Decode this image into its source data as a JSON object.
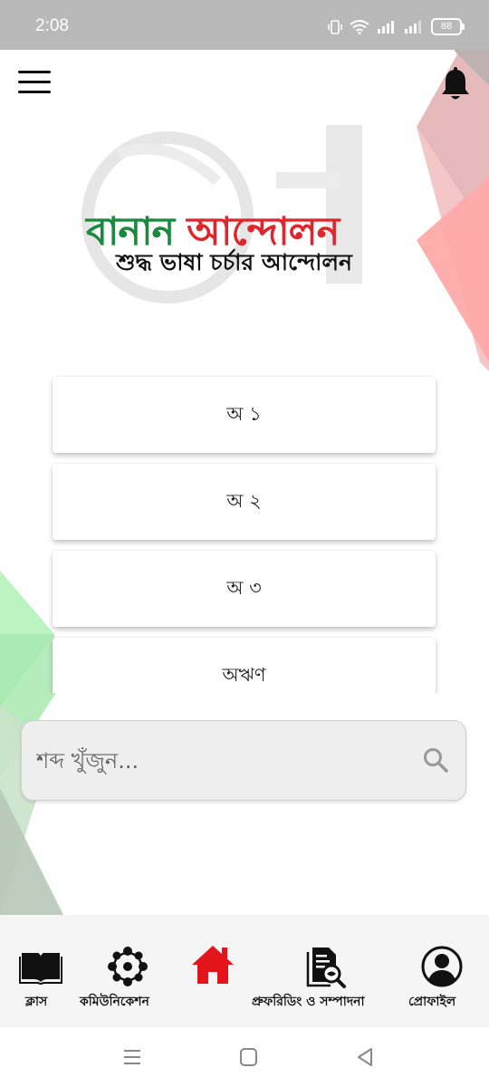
{
  "status_bar": {
    "time": "2:08",
    "battery": "88",
    "icons": [
      "vibrate-icon",
      "wifi-icon",
      "signal-icon",
      "signal-icon",
      "battery-icon"
    ]
  },
  "header": {
    "menu_icon": "hamburger-menu-icon",
    "notification_icon": "bell-icon"
  },
  "logo": {
    "title_part1": "বানান",
    "title_part2": "আন্দোলন",
    "tagline": "শুদ্ধ ভাষা চর্চার আন্দোলন"
  },
  "list": {
    "items": [
      {
        "label": "অ ১"
      },
      {
        "label": "অ ২"
      },
      {
        "label": "অ ৩"
      },
      {
        "label": "অঋণ"
      }
    ]
  },
  "search": {
    "placeholder": "শব্দ খুঁজুন...",
    "icon": "search-icon"
  },
  "bottom_nav": {
    "items": [
      {
        "label": "ক্লাস",
        "icon": "book-icon",
        "active": false
      },
      {
        "label": "কমিউনিকেশন",
        "icon": "network-icon",
        "active": false
      },
      {
        "label": "",
        "icon": "home-icon",
        "active": true
      },
      {
        "label": "প্রুফরিডিং ও সম্পাদনা",
        "icon": "document-search-icon",
        "active": false
      },
      {
        "label": "প্রোফাইল",
        "icon": "profile-icon",
        "active": false
      }
    ]
  },
  "colors": {
    "accent_green": "#1a8a3c",
    "accent_red": "#e0262d",
    "home_active": "#e3151b"
  }
}
